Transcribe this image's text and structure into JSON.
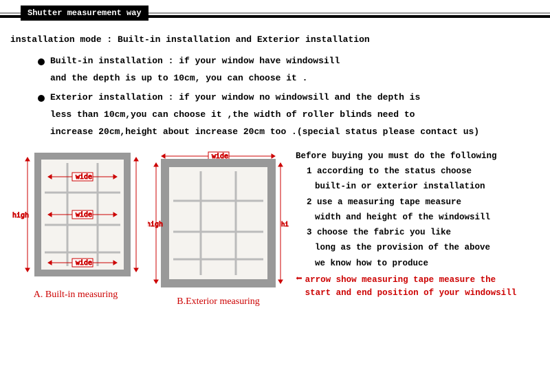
{
  "header": {
    "title": "Shutter measurement way"
  },
  "intro": "installation mode : Built-in installation and Exterior installation",
  "items": [
    {
      "lines": [
        "Built-in installation : if your window have windowsill",
        "and the depth is up to 10cm, you can choose it ."
      ]
    },
    {
      "lines": [
        "Exterior installation : if your window no windowsill and the depth is",
        "less than 10cm,you can choose it ,the width of roller blinds need to",
        "increase 20cm,height about increase 20cm too .(special status please contact us)"
      ]
    }
  ],
  "diagrams": {
    "a": {
      "caption": "A. Built-in measuring",
      "labels": {
        "wide": "wide",
        "high": "high"
      }
    },
    "b": {
      "caption": "B.Exterior measuring",
      "labels": {
        "wide": "wide",
        "high": "high"
      }
    }
  },
  "steps": {
    "lead": "Before buying you must do the following",
    "s1a": "1 according to the status choose",
    "s1b": "built-in or exterior installation",
    "s2a": "2 use a measuring tape measure",
    "s2b": "width and height of the windowsill",
    "s3a": "3 choose the fabric you like",
    "s3b": "long as the provision of the above",
    "s3c": "we know how to produce",
    "note1": "arrow show measuring tape measure the",
    "note2": "start and end position of your windowsill"
  }
}
